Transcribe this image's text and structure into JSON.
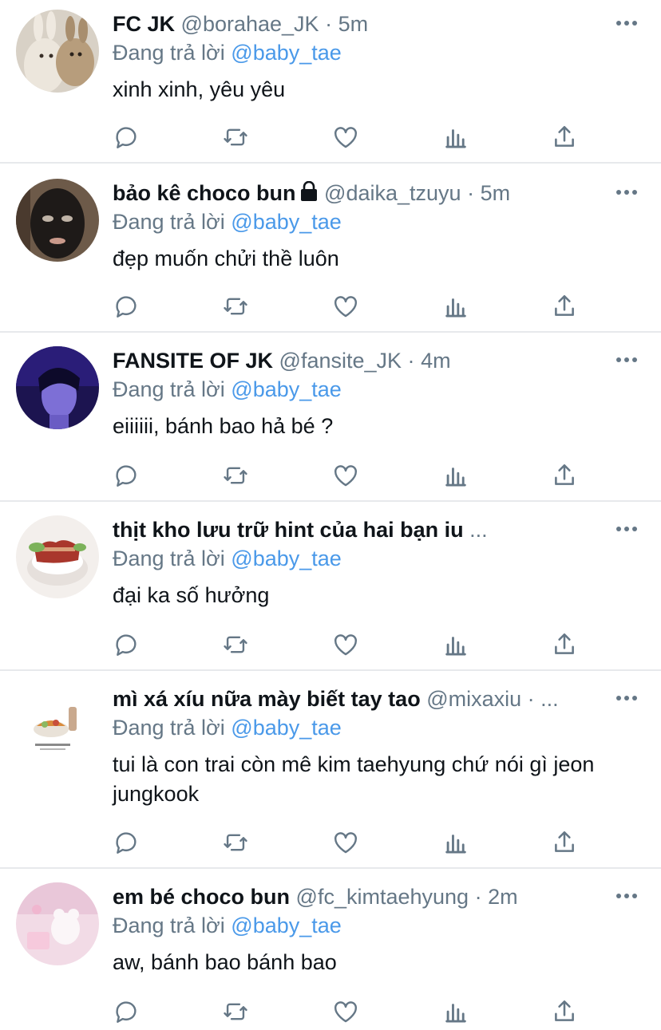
{
  "reply_prefix": "Đang trả lời",
  "colors": {
    "mention": "#4a99e9",
    "muted": "#657786",
    "text": "#0f1419",
    "divider": "#e7e9ec"
  },
  "icons": [
    "more-icon",
    "reply-icon",
    "retweet-icon",
    "like-icon",
    "analytics-icon",
    "share-icon",
    "lock-icon"
  ],
  "tweets": [
    {
      "name": "FC JK",
      "handle": "@borahae_JK",
      "dot": "·",
      "time": "5m",
      "reply_to": "@baby_tae",
      "text": "xinh xinh, yêu yêu",
      "locked": false
    },
    {
      "name": "bảo kê choco bun",
      "handle": "@daika_tzuyu",
      "dot": "·",
      "time": "5m",
      "reply_to": "@baby_tae",
      "text": "đẹp muốn chửi thề luôn",
      "locked": true
    },
    {
      "name": "FANSITE OF JK",
      "handle": "@fansite_JK",
      "dot": "·",
      "time": "4m",
      "reply_to": "@baby_tae",
      "text": "eiiiiii, bánh bao hả bé ?",
      "locked": false
    },
    {
      "name": "thịt kho lưu trữ hint của hai bạn iu",
      "handle": "...",
      "dot": "",
      "time": "",
      "reply_to": "@baby_tae",
      "text": "đại ka số hưởng",
      "locked": false
    },
    {
      "name": "mì xá xíu nữa mày biết tay tao",
      "handle": "@mixaxiu",
      "dot": "·",
      "time": "...",
      "reply_to": "@baby_tae",
      "text": "tui là con trai còn mê kim taehyung chứ nói gì jeon jungkook",
      "locked": false
    },
    {
      "name": "em bé choco bun",
      "handle": "@fc_kimtaehyung",
      "dot": "·",
      "time": "2m",
      "reply_to": "@baby_tae",
      "text": "aw, bánh bao bánh bao",
      "locked": false
    }
  ]
}
